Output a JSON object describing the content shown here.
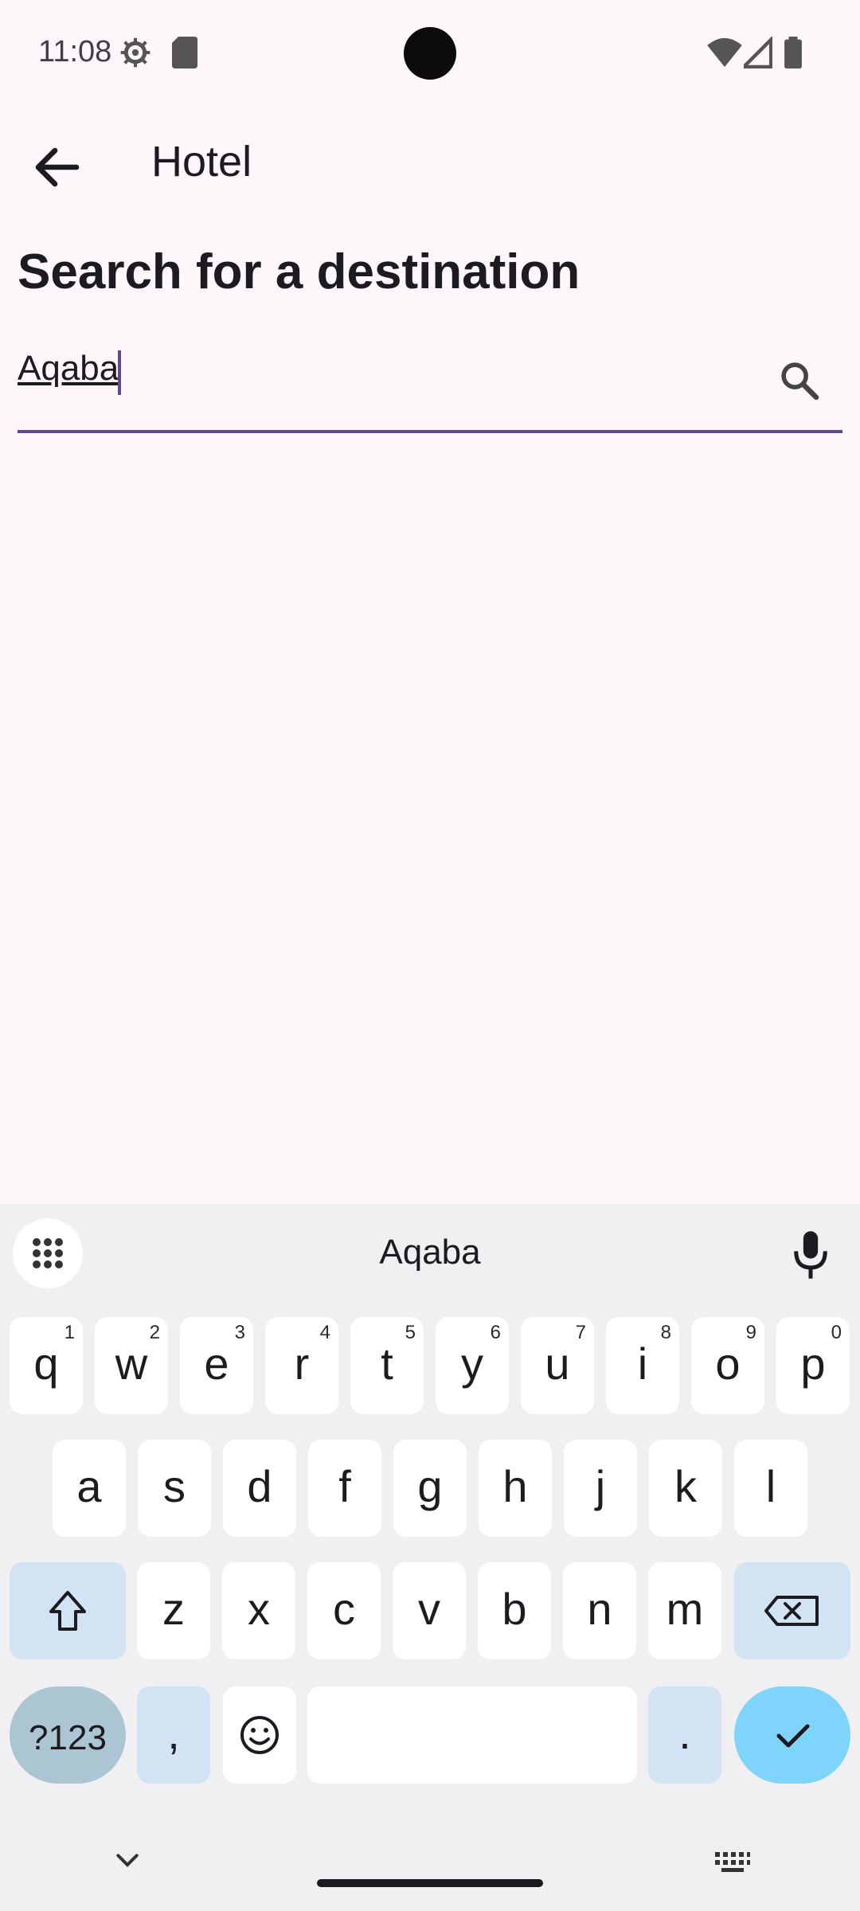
{
  "status": {
    "time": "11:08"
  },
  "appbar": {
    "title": "Hotel"
  },
  "main": {
    "heading": "Search for a destination",
    "search_value": "Aqaba"
  },
  "keyboard": {
    "suggestion": "Aqaba",
    "row1": [
      {
        "ch": "q",
        "sup": "1"
      },
      {
        "ch": "w",
        "sup": "2"
      },
      {
        "ch": "e",
        "sup": "3"
      },
      {
        "ch": "r",
        "sup": "4"
      },
      {
        "ch": "t",
        "sup": "5"
      },
      {
        "ch": "y",
        "sup": "6"
      },
      {
        "ch": "u",
        "sup": "7"
      },
      {
        "ch": "i",
        "sup": "8"
      },
      {
        "ch": "o",
        "sup": "9"
      },
      {
        "ch": "p",
        "sup": "0"
      }
    ],
    "row2": [
      "a",
      "s",
      "d",
      "f",
      "g",
      "h",
      "j",
      "k",
      "l"
    ],
    "row3": [
      "z",
      "x",
      "c",
      "v",
      "b",
      "n",
      "m"
    ],
    "symbols_label": "?123",
    "comma": ",",
    "period": "."
  },
  "colors": {
    "accent": "#5d4a8a",
    "enter": "#7fd4fb",
    "background": "#fdf7fc"
  }
}
